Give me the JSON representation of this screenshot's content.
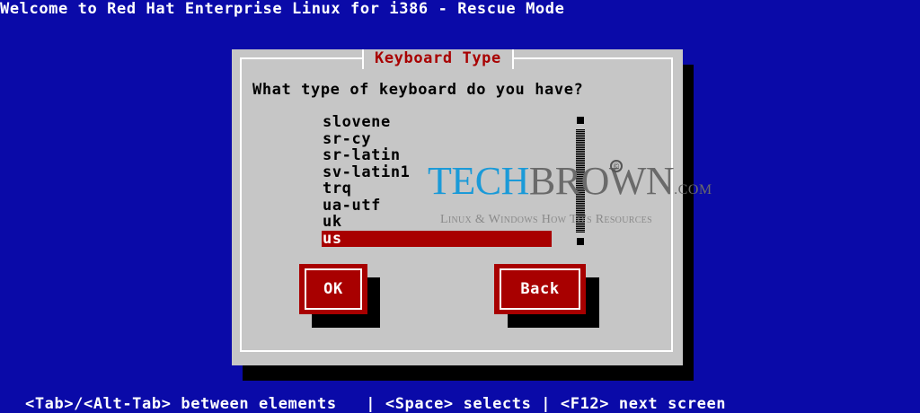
{
  "screen": {
    "title": "Welcome to Red Hat Enterprise Linux for i386 - Rescue Mode",
    "footer": "<Tab>/<Alt-Tab> between elements   | <Space> selects | <F12> next screen",
    "colors": {
      "background": "#0a0aa8",
      "dialog": "#c6c6c6",
      "accent": "#a80000",
      "text": "#ffffff"
    }
  },
  "dialog": {
    "title": "Keyboard Type",
    "question": "What type of keyboard do you have?",
    "keyboards": [
      {
        "label": "slovene",
        "selected": false
      },
      {
        "label": "sr-cy",
        "selected": false
      },
      {
        "label": "sr-latin",
        "selected": false
      },
      {
        "label": "sv-latin1",
        "selected": false
      },
      {
        "label": "trq",
        "selected": false
      },
      {
        "label": "ua-utf",
        "selected": false
      },
      {
        "label": "uk",
        "selected": false
      },
      {
        "label": "us",
        "selected": true
      }
    ],
    "buttons": {
      "ok": "OK",
      "back": "Back"
    }
  },
  "watermark": {
    "logo_tech": "TECH",
    "logo_brown": "BROWN",
    "logo_domain": ".COM",
    "copyright_symbol": "©",
    "tagline": "Linux & Windows How To's Resources"
  }
}
